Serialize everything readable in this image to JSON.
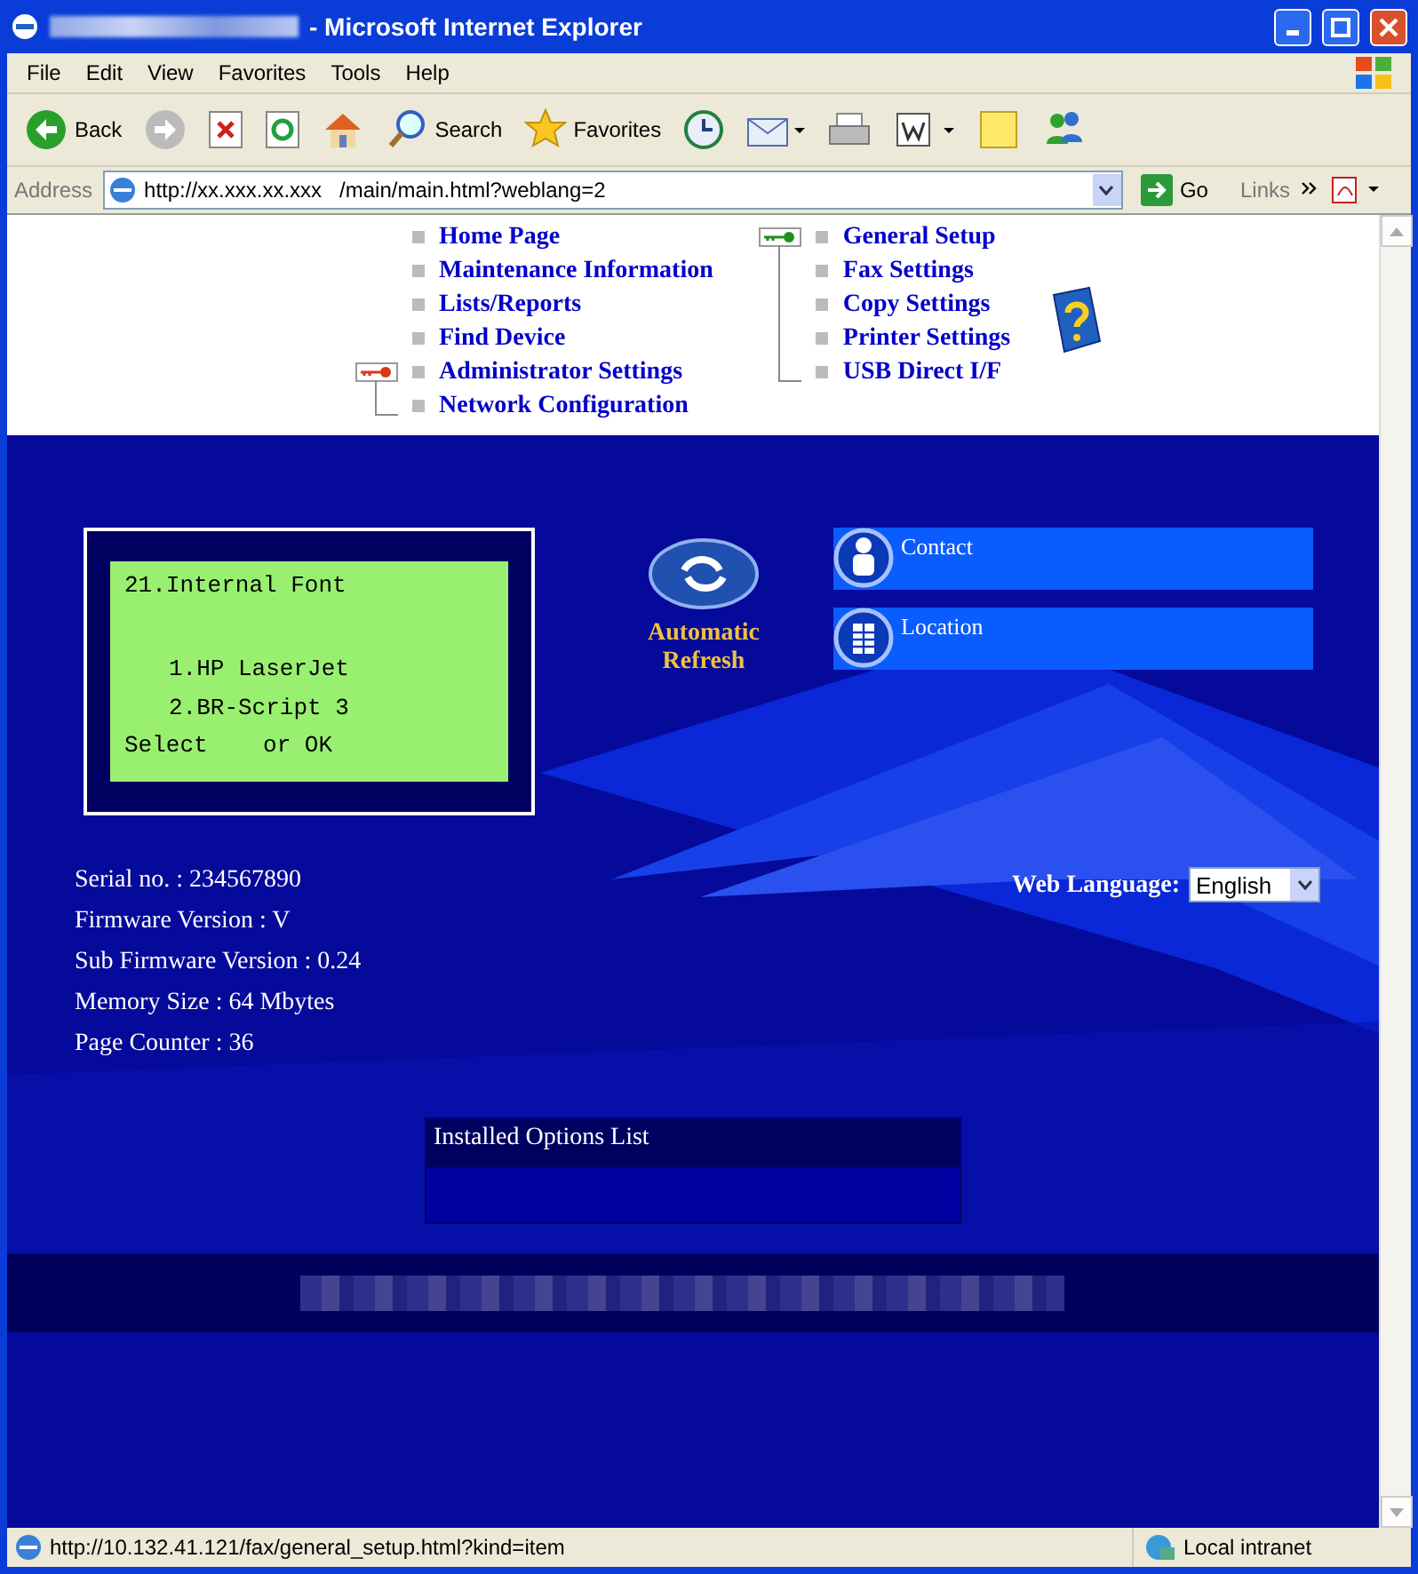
{
  "window": {
    "title": "- Microsoft Internet Explorer"
  },
  "menu": [
    {
      "label": "File"
    },
    {
      "label": "Edit"
    },
    {
      "label": "View"
    },
    {
      "label": "Favorites"
    },
    {
      "label": "Tools"
    },
    {
      "label": "Help"
    }
  ],
  "toolbar": [
    {
      "kind": "back",
      "label": "Back"
    },
    {
      "kind": "forward"
    },
    {
      "kind": "stop"
    },
    {
      "kind": "refresh"
    },
    {
      "kind": "home"
    },
    {
      "kind": "search",
      "label": "Search"
    },
    {
      "kind": "favorites",
      "label": "Favorites"
    },
    {
      "kind": "history"
    },
    {
      "kind": "mail"
    },
    {
      "kind": "print"
    },
    {
      "kind": "edit"
    },
    {
      "kind": "note"
    },
    {
      "kind": "messenger"
    }
  ],
  "address": {
    "label": "Address",
    "value": "http://xx.xxx.xx.xxx   /main/main.html?weblang=2",
    "go": "Go",
    "links": "Links"
  },
  "nav": [
    {
      "items": [
        {
          "label": "Home Page"
        },
        {
          "label": "Maintenance Information"
        },
        {
          "label": "Lists/Reports"
        },
        {
          "label": "Find Device"
        }
      ],
      "secured": {
        "color": "#d83818",
        "items": [
          {
            "label": "Administrator Settings"
          },
          {
            "label": "Network Configuration"
          }
        ]
      }
    },
    {
      "secured": {
        "color": "#209020",
        "items": [
          {
            "label": "General Setup"
          },
          {
            "label": "Fax Settings"
          },
          {
            "label": "Copy Settings"
          },
          {
            "label": "Printer Settings"
          },
          {
            "label": "USB Direct I/F"
          }
        ]
      }
    }
  ],
  "lcd": {
    "lines": [
      {
        "kind": "heading",
        "text": "21.Internal Font"
      },
      {
        "kind": "option",
        "text": "1.HP LaserJet"
      },
      {
        "kind": "option",
        "text": "2.BR-Script 3"
      },
      {
        "kind": "footer",
        "text": "Select    or OK"
      }
    ]
  },
  "refresh": {
    "label": "Automatic Refresh"
  },
  "info_buttons": [
    {
      "kind": "person",
      "label": "Contact"
    },
    {
      "kind": "building",
      "label": "Location"
    }
  ],
  "device_info": [
    "Serial no. : 234567890",
    "Firmware Version : V",
    "Sub Firmware Version : 0.24",
    "Memory Size : 64 Mbytes",
    "Page Counter : 36"
  ],
  "web_language": {
    "label": "Web Language:",
    "value": "English"
  },
  "installed_options": {
    "title": "Installed Options List"
  },
  "status_bar": {
    "url": "http://10.132.41.121/fax/general_setup.html?kind=item",
    "zone": "Local intranet"
  }
}
